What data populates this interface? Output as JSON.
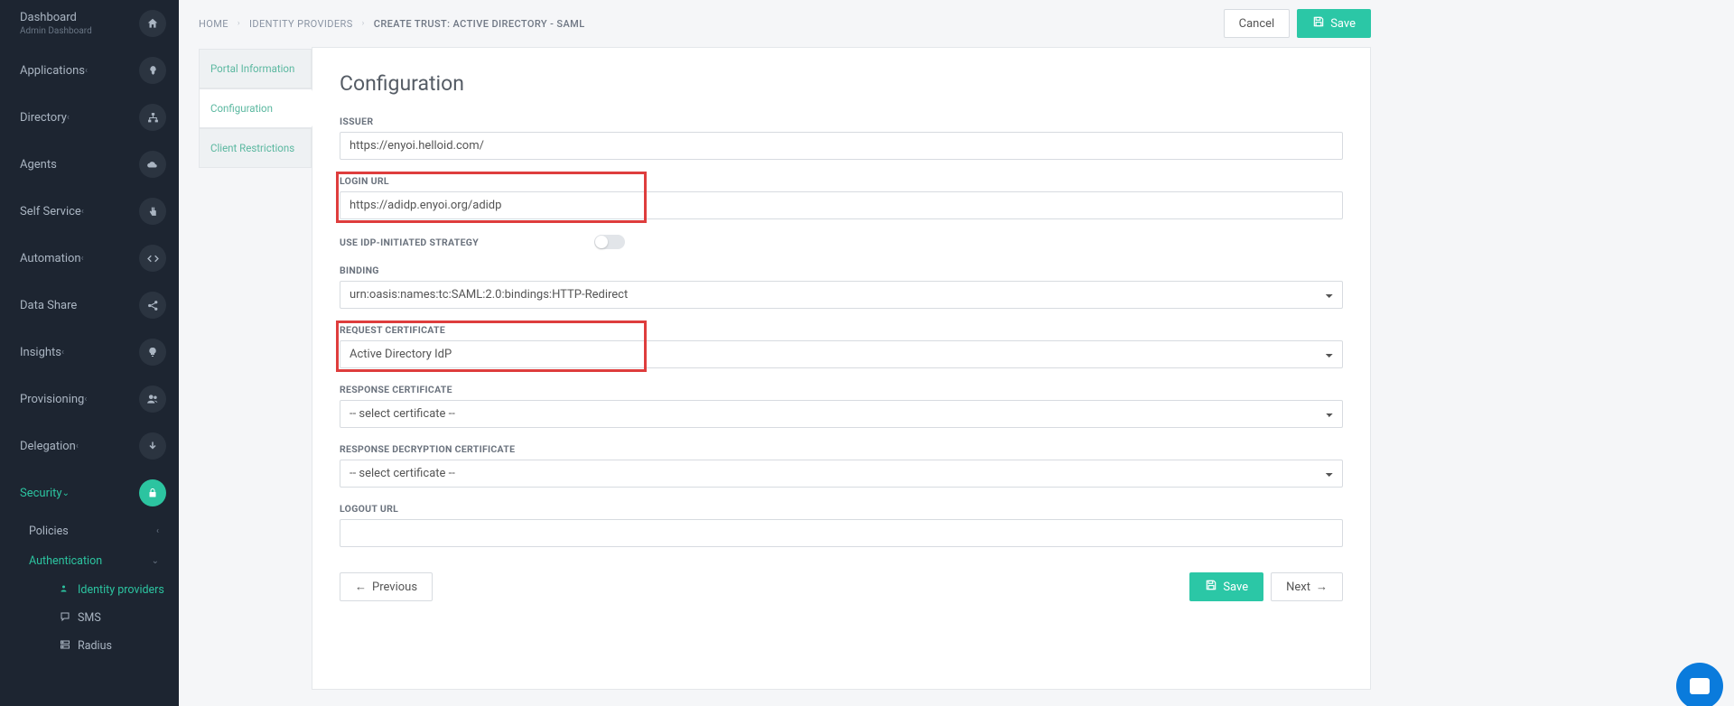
{
  "sidebar": {
    "items": [
      {
        "label": "Dashboard",
        "sublabel": "Admin Dashboard"
      },
      {
        "label": "Applications"
      },
      {
        "label": "Directory"
      },
      {
        "label": "Agents"
      },
      {
        "label": "Self Service"
      },
      {
        "label": "Automation"
      },
      {
        "label": "Data Share"
      },
      {
        "label": "Insights"
      },
      {
        "label": "Provisioning"
      },
      {
        "label": "Delegation"
      },
      {
        "label": "Security"
      }
    ],
    "security_children": [
      {
        "label": "Policies"
      },
      {
        "label": "Authentication"
      }
    ],
    "auth_children": [
      {
        "label": "Identity providers"
      },
      {
        "label": "SMS"
      },
      {
        "label": "Radius"
      }
    ]
  },
  "breadcrumb": {
    "items": [
      "HOME",
      "IDENTITY PROVIDERS",
      "CREATE TRUST: ACTIVE DIRECTORY - SAML"
    ]
  },
  "actions": {
    "cancel": "Cancel",
    "save": "Save",
    "previous": "Previous",
    "next": "Next"
  },
  "tabs": [
    {
      "label": "Portal Information"
    },
    {
      "label": "Configuration"
    },
    {
      "label": "Client Restrictions"
    }
  ],
  "panel": {
    "title": "Configuration",
    "issuer": {
      "label": "Issuer",
      "value": "https://enyoi.helloid.com/"
    },
    "login_url": {
      "label": "Login URL",
      "value": "https://adidp.enyoi.org/adidp"
    },
    "idp_strategy": {
      "label": "Use IdP-initiated strategy"
    },
    "binding": {
      "label": "Binding",
      "value": "urn:oasis:names:tc:SAML:2.0:bindings:HTTP-Redirect"
    },
    "req_cert": {
      "label": "Request Certificate",
      "value": "Active Directory IdP"
    },
    "resp_cert": {
      "label": "Response Certificate",
      "placeholder": "-- select certificate --"
    },
    "resp_dec_cert": {
      "label": "Response Decryption Certificate",
      "placeholder": "-- select certificate --"
    },
    "logout_url": {
      "label": "Logout URL",
      "value": ""
    }
  }
}
